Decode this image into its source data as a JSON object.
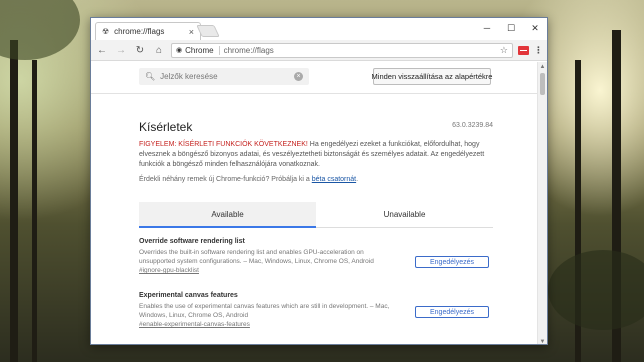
{
  "browser": {
    "tab_title": "chrome://flags",
    "tab_close": "×",
    "window_controls": {
      "minimize": "─",
      "maximize": "☐",
      "close": "✕"
    },
    "omnibox_chip": "Chrome",
    "url": "chrome://flags",
    "menu_glyph": "⋮"
  },
  "toolbar": {
    "search_placeholder": "Jelzők keresése",
    "reset_label": "Minden visszaállítása az alapértékre"
  },
  "page": {
    "title": "Kísérletek",
    "version": "63.0.3239.84",
    "warning_red": "FIGYELEM: KÍSÉRLETI FUNKCIÓK KÖVETKEZNEK!",
    "warning_text": " Ha engedélyezi ezeket a funkciókat, előfordulhat, hogy elvesznek a böngésző bizonyos adatai, és veszélyeztetheti biztonságát és személyes adatait. Az engedélyezett funkciók a böngésző minden felhasználójára vonatkoznak.",
    "note_text": "Érdekli néhány remek új Chrome-funkció? Próbálja ki a ",
    "note_link": "béta csatornát",
    "note_end": "."
  },
  "tabs": {
    "available": "Available",
    "unavailable": "Unavailable"
  },
  "flags": [
    {
      "title": "Override software rendering list",
      "description": "Overrides the built-in software rendering list and enables GPU-acceleration on unsupported system configurations. – Mac, Windows, Linux, Chrome OS, Android",
      "hash": "#ignore-gpu-blacklist",
      "button": "Engedélyezés"
    },
    {
      "title": "Experimental canvas features",
      "description": "Enables the use of experimental canvas features which are still in development. – Mac, Windows, Linux, Chrome OS, Android",
      "hash": "#enable-experimental-canvas-features",
      "button": "Engedélyezés"
    }
  ],
  "colors": {
    "accent": "#3b78e7",
    "warning": "#c5221f",
    "link": "#1a56a5",
    "extension": "#e2353a"
  }
}
